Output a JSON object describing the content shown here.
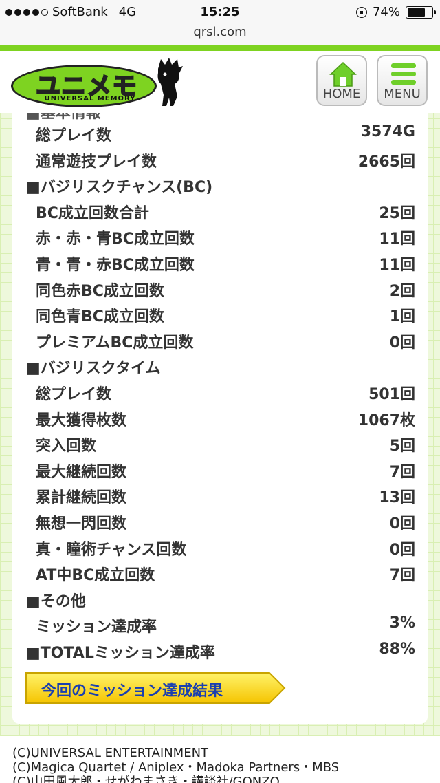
{
  "status": {
    "carrier": "SoftBank",
    "network": "4G",
    "time": "15:25",
    "battery": "74%",
    "battery_level": 0.74
  },
  "url": "qrsl.com",
  "header": {
    "logo_text": "ユニメモ",
    "logo_sub": "UNIVERSAL MEMORY",
    "home_label": "HOME",
    "menu_label": "MENU"
  },
  "partial_heading": "■基本情報",
  "sections": {
    "basic": {
      "rows": [
        {
          "k": "総プレイ数",
          "v": "3574G"
        },
        {
          "k": "通常遊技プレイ数",
          "v": "2665回"
        }
      ]
    },
    "bc": {
      "title": "■バジリスクチャンス(BC)",
      "rows": [
        {
          "k": "BC成立回数合計",
          "v": "25回"
        },
        {
          "k": "赤・赤・青BC成立回数",
          "v": "11回"
        },
        {
          "k": "青・青・赤BC成立回数",
          "v": "11回"
        },
        {
          "k": "同色赤BC成立回数",
          "v": "2回"
        },
        {
          "k": "同色青BC成立回数",
          "v": "1回"
        },
        {
          "k": "プレミアムBC成立回数",
          "v": "0回"
        }
      ]
    },
    "bt": {
      "title": "■バジリスクタイム",
      "rows": [
        {
          "k": "総プレイ数",
          "v": "501回"
        },
        {
          "k": "最大獲得枚数",
          "v": "1067枚"
        },
        {
          "k": "突入回数",
          "v": "5回"
        },
        {
          "k": "最大継続回数",
          "v": "7回"
        },
        {
          "k": "累計継続回数",
          "v": "13回"
        },
        {
          "k": "無想一閃回数",
          "v": "0回"
        },
        {
          "k": "真・瞳術チャンス回数",
          "v": "0回"
        },
        {
          "k": "AT中BC成立回数",
          "v": "7回"
        }
      ]
    },
    "other": {
      "title": "■その他",
      "rows": [
        {
          "k": "ミッション達成率",
          "v": "3%"
        }
      ]
    },
    "total": {
      "k": "■TOTALミッション達成率",
      "v": "88%"
    }
  },
  "result_button": "今回のミッション達成結果",
  "footer": [
    "(C)UNIVERSAL ENTERTAINMENT",
    "(C)Magica Quartet / Aniplex・Madoka Partners・MBS",
    "(C)山田風太郎・せがわまさき・講談社/GONZO"
  ],
  "colors": {
    "accent_green": "#7ed321",
    "button_yellow": "#ffd700",
    "link_blue": "#1a3fb0"
  }
}
